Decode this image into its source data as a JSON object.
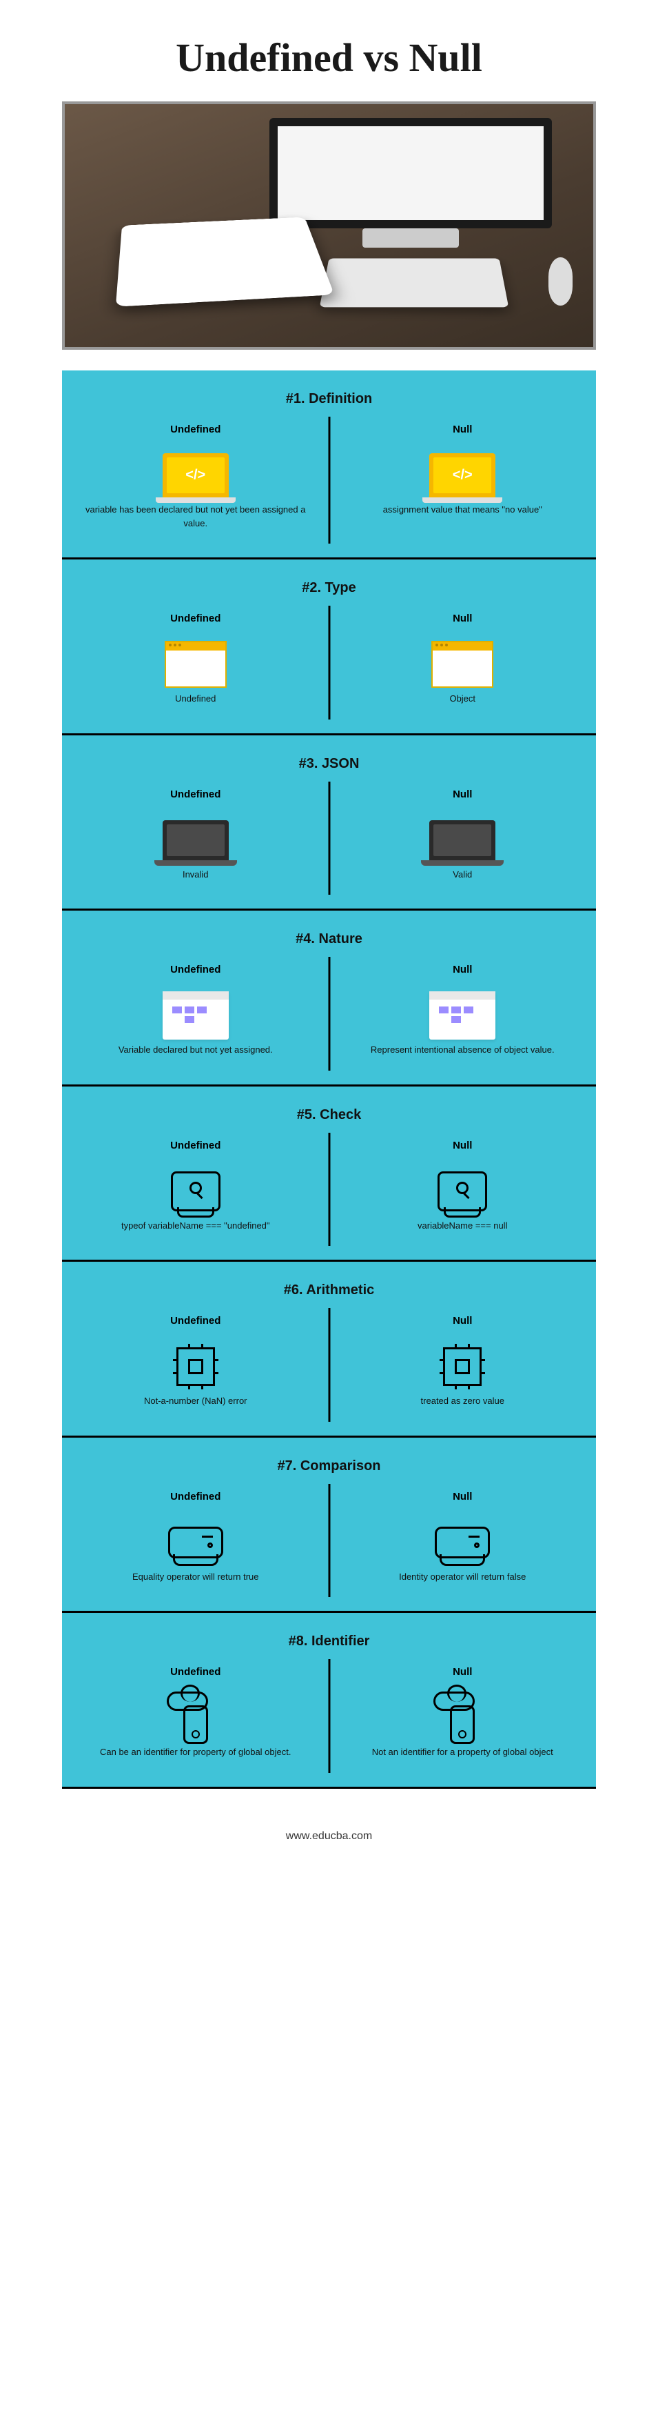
{
  "title": "Undefined vs Null",
  "footer": "www.educba.com",
  "labels": {
    "left": "Undefined",
    "right": "Null"
  },
  "sections": [
    {
      "title": "#1. Definition",
      "left": "variable has been declared but not yet been assigned a value.",
      "right": "assignment value that means \"no value\""
    },
    {
      "title": "#2. Type",
      "left": "Undefined",
      "right": "Object"
    },
    {
      "title": "#3. JSON",
      "left": "Invalid",
      "right": "Valid"
    },
    {
      "title": "#4. Nature",
      "left": "Variable declared but not yet assigned.",
      "right": "Represent intentional absence of object value."
    },
    {
      "title": "#5. Check",
      "left": "typeof variableName === \"undefined\"",
      "right": "variableName === null"
    },
    {
      "title": "#6. Arithmetic",
      "left": "Not-a-number (NaN) error",
      "right": "treated as zero value"
    },
    {
      "title": "#7. Comparison",
      "left": "Equality operator will return true",
      "right": "Identity operator will return false"
    },
    {
      "title": "#8. Identifier",
      "left": "Can be an identifier for property of global object.",
      "right": "Not an identifier for a property of global object"
    }
  ]
}
